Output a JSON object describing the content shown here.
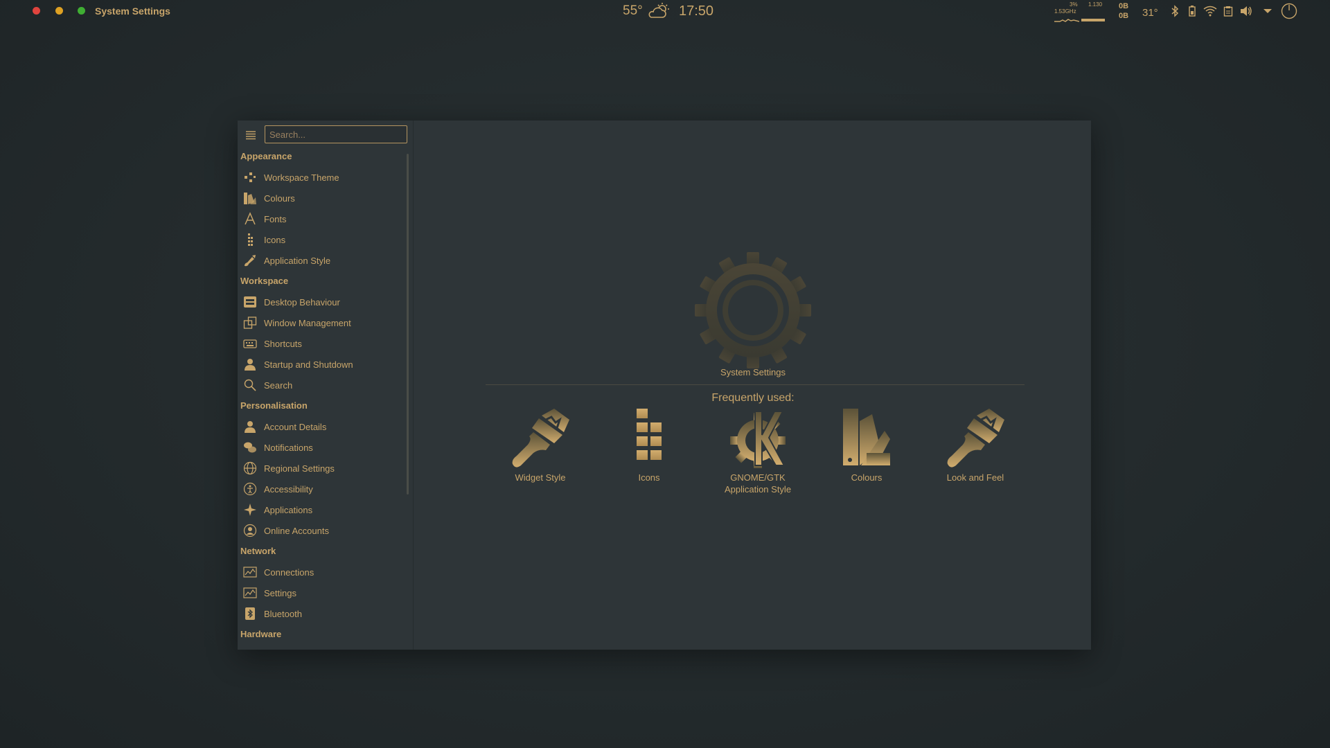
{
  "topbar": {
    "app_title": "System Settings",
    "weather_temp": "55°",
    "clock": "17:50",
    "cpu_percent": "3%",
    "cpu_freq": "1.53GHz",
    "load": "1.130",
    "net_up": "0B",
    "net_down": "0B",
    "temperature": "31°",
    "icons": [
      "bluetooth-icon",
      "battery-icon",
      "wifi-icon",
      "clipboard-icon",
      "volume-icon",
      "expand-arrow-icon",
      "power-icon"
    ]
  },
  "sidebar": {
    "search_placeholder": "Search...",
    "categories": [
      {
        "name": "Appearance",
        "items": [
          {
            "label": "Workspace Theme",
            "icon": "workspace-theme-icon"
          },
          {
            "label": "Colours",
            "icon": "colours-icon"
          },
          {
            "label": "Fonts",
            "icon": "fonts-icon"
          },
          {
            "label": "Icons",
            "icon": "icons-icon"
          },
          {
            "label": "Application Style",
            "icon": "application-style-icon"
          }
        ]
      },
      {
        "name": "Workspace",
        "items": [
          {
            "label": "Desktop Behaviour",
            "icon": "desktop-behaviour-icon"
          },
          {
            "label": "Window Management",
            "icon": "window-management-icon"
          },
          {
            "label": "Shortcuts",
            "icon": "keyboard-icon"
          },
          {
            "label": "Startup and Shutdown",
            "icon": "startup-icon"
          },
          {
            "label": "Search",
            "icon": "search-icon"
          }
        ]
      },
      {
        "name": "Personalisation",
        "items": [
          {
            "label": "Account Details",
            "icon": "user-icon"
          },
          {
            "label": "Notifications",
            "icon": "notifications-icon"
          },
          {
            "label": "Regional Settings",
            "icon": "globe-icon"
          },
          {
            "label": "Accessibility",
            "icon": "accessibility-icon"
          },
          {
            "label": "Applications",
            "icon": "star-icon"
          },
          {
            "label": "Online Accounts",
            "icon": "online-accounts-icon"
          }
        ]
      },
      {
        "name": "Network",
        "items": [
          {
            "label": "Connections",
            "icon": "connections-icon"
          },
          {
            "label": "Settings",
            "icon": "network-settings-icon"
          },
          {
            "label": "Bluetooth",
            "icon": "bluetooth-icon"
          }
        ]
      },
      {
        "name": "Hardware",
        "items": []
      }
    ]
  },
  "main": {
    "hero_label": "System Settings",
    "frequently_used_title": "Frequently used:",
    "frequent": [
      {
        "label": "Widget Style",
        "icon": "brush-icon"
      },
      {
        "label": "Icons",
        "icon": "icons-grid-icon"
      },
      {
        "label": "GNOME/GTK\nApplication Style",
        "icon": "kde-gear-icon"
      },
      {
        "label": "Colours",
        "icon": "colour-swatch-icon"
      },
      {
        "label": "Look and Feel",
        "icon": "brush-icon"
      }
    ]
  },
  "colors": {
    "accent": "#c8a56a",
    "background": "#232a2c",
    "window": "#2e3538"
  }
}
